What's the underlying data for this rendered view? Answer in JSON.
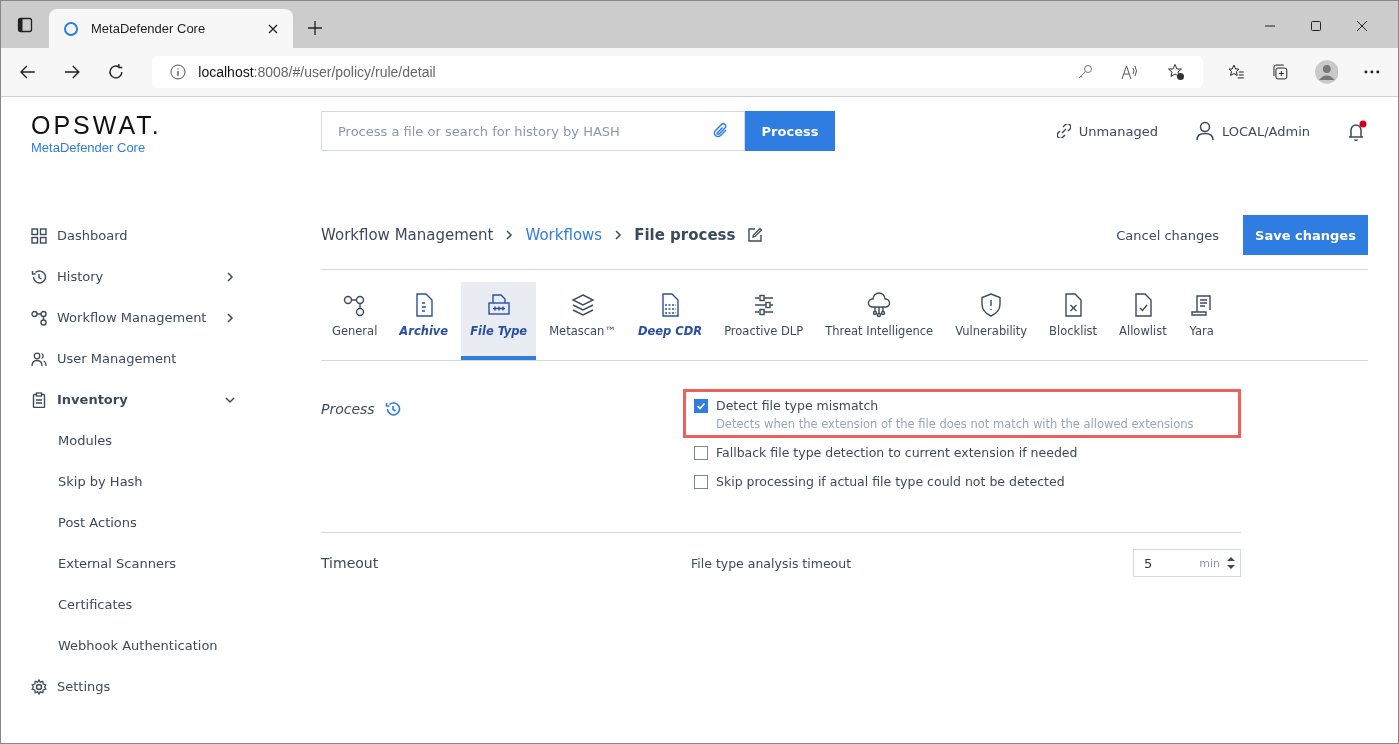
{
  "browser": {
    "tab_title": "MetaDefender Core",
    "url_host": "localhost",
    "url_path": ":8008/#/user/policy/rule/detail"
  },
  "header": {
    "logo": "OPSWAT.",
    "product": "MetaDefender Core",
    "search": {
      "placeholder": "Process a file or search for history by HASH"
    },
    "process_button": "Process",
    "status": "Unmanaged",
    "user": "LOCAL/Admin",
    "notification": true
  },
  "sidebar": {
    "items": [
      {
        "label": "Dashboard"
      },
      {
        "label": "History",
        "expanded": false
      },
      {
        "label": "Workflow Management",
        "expanded": false
      },
      {
        "label": "User Management"
      },
      {
        "label": "Inventory",
        "expanded": true,
        "children": [
          {
            "label": "Modules"
          },
          {
            "label": "Skip by Hash"
          },
          {
            "label": "Post Actions"
          },
          {
            "label": "External Scanners"
          },
          {
            "label": "Certificates"
          },
          {
            "label": "Webhook Authentication"
          }
        ]
      },
      {
        "label": "Settings"
      }
    ]
  },
  "breadcrumb": [
    {
      "label": "Workflow Management",
      "link": false
    },
    {
      "label": "Workflows",
      "link": true
    },
    {
      "label": "File process",
      "link": false
    }
  ],
  "actions": {
    "cancel": "Cancel changes",
    "save": "Save changes"
  },
  "tabs": [
    {
      "label": "General",
      "selected": false,
      "modified": false
    },
    {
      "label": "Archive",
      "selected": false,
      "modified": true
    },
    {
      "label": "File Type",
      "selected": true,
      "modified": true
    },
    {
      "label": "Metascan™",
      "selected": false,
      "modified": false
    },
    {
      "label": "Deep CDR",
      "selected": false,
      "modified": true
    },
    {
      "label": "Proactive DLP",
      "selected": false,
      "modified": false
    },
    {
      "label": "Threat Intelligence",
      "selected": false,
      "modified": false
    },
    {
      "label": "Vulnerability",
      "selected": false,
      "modified": false
    },
    {
      "label": "Blocklist",
      "selected": false,
      "modified": false
    },
    {
      "label": "Allowlist",
      "selected": false,
      "modified": false
    },
    {
      "label": "Yara",
      "selected": false,
      "modified": false
    }
  ],
  "process": {
    "title": "Process",
    "modified": true,
    "options": [
      {
        "label": "Detect file type mismatch",
        "checked": true,
        "highlighted": true,
        "description": "Detects when the extension of the file does not match with the allowed extensions"
      },
      {
        "label": "Fallback file type detection to current extension if needed",
        "checked": false,
        "highlighted": false
      },
      {
        "label": "Skip processing if actual file type could not be detected",
        "checked": false,
        "highlighted": false
      }
    ]
  },
  "timeout": {
    "title": "Timeout",
    "label": "File type analysis timeout",
    "value": "5",
    "unit": "min"
  }
}
